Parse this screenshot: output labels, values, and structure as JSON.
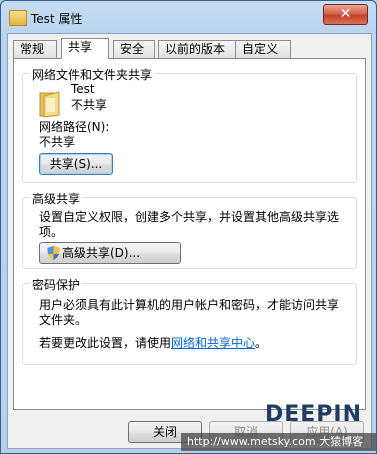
{
  "window": {
    "title": "Test 属性",
    "close_glyph": "✕"
  },
  "tabs": [
    {
      "label": "常规"
    },
    {
      "label": "共享"
    },
    {
      "label": "安全"
    },
    {
      "label": "以前的版本"
    },
    {
      "label": "自定义"
    }
  ],
  "sharing": {
    "legend": "网络文件和文件夹共享",
    "folder_name": "Test",
    "folder_status": "不共享",
    "path_label": "网络路径(N):",
    "path_value": "不共享",
    "share_button": "共享(S)..."
  },
  "advanced": {
    "legend": "高级共享",
    "desc_line1": "设置自定义权限，创建多个共享，并设置其他高级共享选",
    "desc_line2": "项。",
    "button": "高级共享(D)..."
  },
  "password": {
    "legend": "密码保护",
    "desc_line1": "用户必须具有此计算机的用户帐户和密码，才能访问共享",
    "desc_line2": "文件夹。",
    "change_prefix": "若要更改此设置，请使用",
    "change_link": "网络和共享中心",
    "change_suffix": "。"
  },
  "footer": {
    "close_button": "关闭",
    "cancel_button": "取消",
    "apply_button": "应用(A)"
  },
  "watermark": {
    "logo_text": "DEEPIN",
    "url_text": "http://www.metsky.com 大猿博客"
  }
}
